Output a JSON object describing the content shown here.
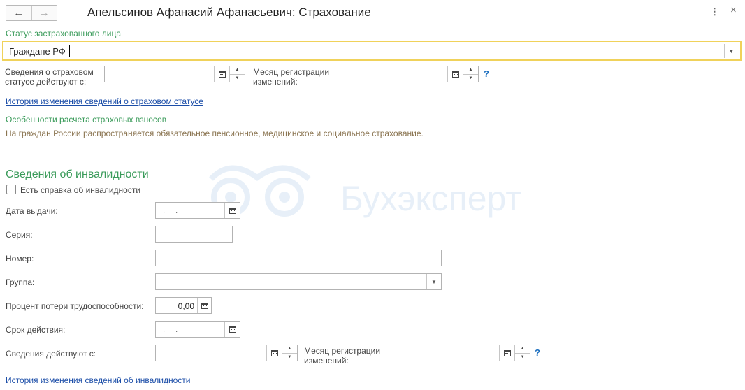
{
  "header": {
    "title": "Апельсинов Афанасий Афанасьевич: Страхование",
    "back_icon": "←",
    "forward_icon": "→",
    "more_icon": "⋮",
    "close_icon": "×"
  },
  "insured_status": {
    "label": "Статус застрахованного лица",
    "value": "Граждане РФ"
  },
  "status_effective": {
    "label_line1": "Сведения о страховом",
    "label_line2": "статусе действуют с:",
    "value": ""
  },
  "status_reg_month": {
    "label_line1": "Месяц регистрации",
    "label_line2": "изменений:",
    "value": "",
    "help": "?"
  },
  "status_history_link": "История изменения сведений о страховом статусе",
  "contrib": {
    "heading": "Особенности расчета страховых взносов",
    "text": "На граждан России распространяется обязательное пенсионное, медицинское и социальное страхование."
  },
  "disability": {
    "heading": "Сведения об инвалидности",
    "has_certificate_label": "Есть справка об инвалидности",
    "issue_date_label": "Дата выдачи:",
    "issue_date_value": ". .",
    "series_label": "Серия:",
    "series_value": "",
    "number_label": "Номер:",
    "number_value": "",
    "group_label": "Группа:",
    "group_value": "",
    "percent_label": "Процент потери трудоспособности:",
    "percent_value": "0,00",
    "validity_label": "Срок действия:",
    "validity_value": ". .",
    "effective_label": "Сведения действуют с:",
    "effective_value": "",
    "reg_month_label_line1": "Месяц регистрации",
    "reg_month_label_line2": "изменений:",
    "reg_month_value": "",
    "help": "?",
    "history_link": "История изменения сведений об инвалидности"
  },
  "watermark": "Бухэксперт",
  "colors": {
    "accent_green": "#3a9b5a",
    "link_blue": "#1c4ea8",
    "focus_yellow": "#f0d25a"
  }
}
